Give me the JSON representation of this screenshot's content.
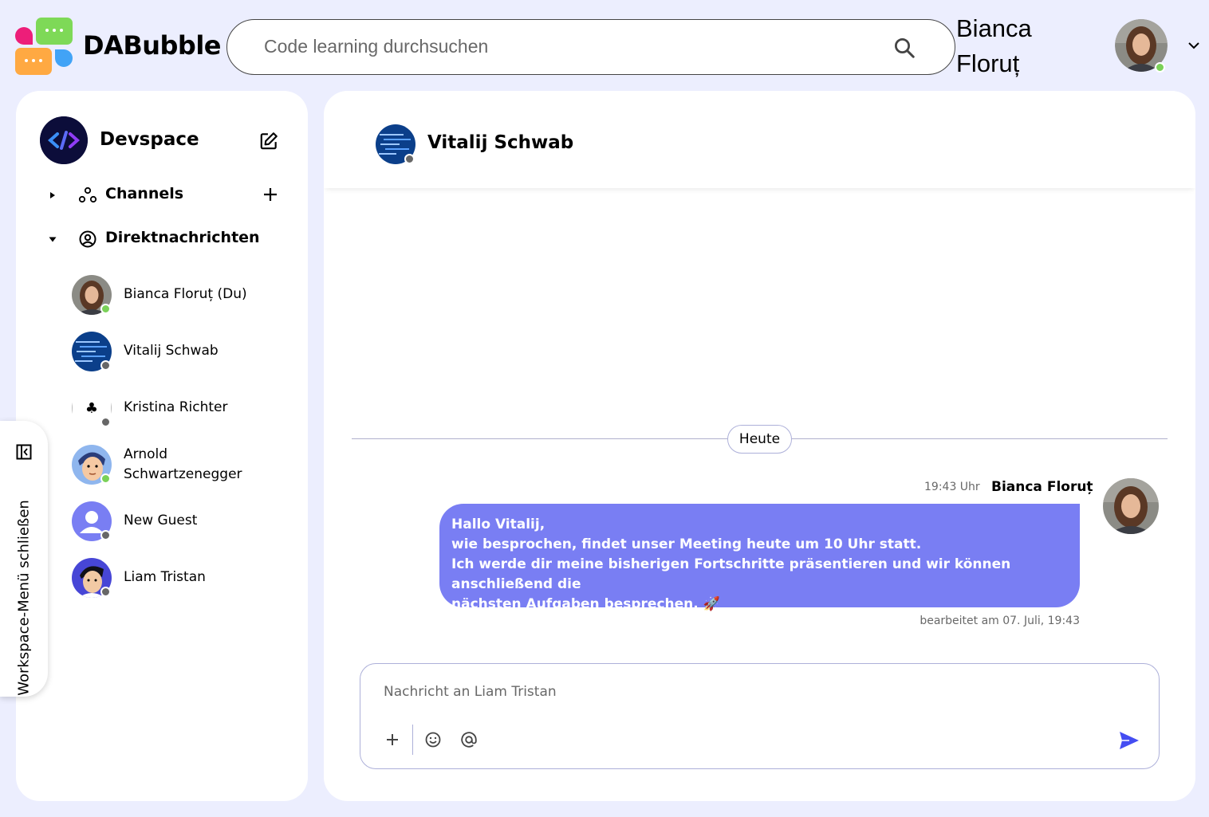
{
  "app": {
    "brand": "DABubble"
  },
  "search": {
    "placeholder": "Code learning durchsuchen"
  },
  "current_user": {
    "name_line1": "Bianca",
    "name_line2": "Floruț",
    "status": "online"
  },
  "workspace": {
    "name": "Devspace"
  },
  "sections": {
    "channels": {
      "label": "Channels",
      "expanded": false
    },
    "direct_messages": {
      "label": "Direktnachrichten",
      "expanded": true
    }
  },
  "dm_list": [
    {
      "name": "Bianca Floruț (Du)",
      "status": "online"
    },
    {
      "name": "Vitalij Schwab",
      "status": "offline"
    },
    {
      "name": "Kristina Richter",
      "status": "offline"
    },
    {
      "name_line1": "Arnold",
      "name_line2": "Schwartzenegger",
      "status": "online"
    },
    {
      "name": "New Guest",
      "status": "offline"
    },
    {
      "name": "Liam Tristan",
      "status": "offline"
    }
  ],
  "sidebar_toggle": {
    "label": "Workspace-Menü schließen"
  },
  "chat": {
    "partner_name": "Vitalij Schwab",
    "partner_status": "offline",
    "day_label": "Heute",
    "messages": [
      {
        "time": "19:43 Uhr",
        "author": "Bianca Floruț",
        "lines": [
          "Hallo Vitalij,",
          "wie besprochen, findet unser Meeting heute um 10 Uhr statt.",
          "Ich werde dir meine bisherigen Fortschritte präsentieren und wir können anschließend die",
          "nächsten Aufgaben besprechen. 🚀"
        ],
        "edited": "bearbeitet am 07. Juli, 19:43"
      }
    ]
  },
  "composer": {
    "placeholder": "Nachricht an Liam Tristan"
  },
  "colors": {
    "accent": "#797ef3",
    "page_bg": "#eceefe",
    "online": "#7ad158",
    "offline": "#676767"
  },
  "icons": [
    "search-icon",
    "chevron-down-icon",
    "edit-icon",
    "caret-right-icon",
    "caret-down-icon",
    "channels-icon",
    "account-circle-icon",
    "plus-icon",
    "sidebar-collapse-icon",
    "smiley-icon",
    "at-icon",
    "send-icon"
  ]
}
